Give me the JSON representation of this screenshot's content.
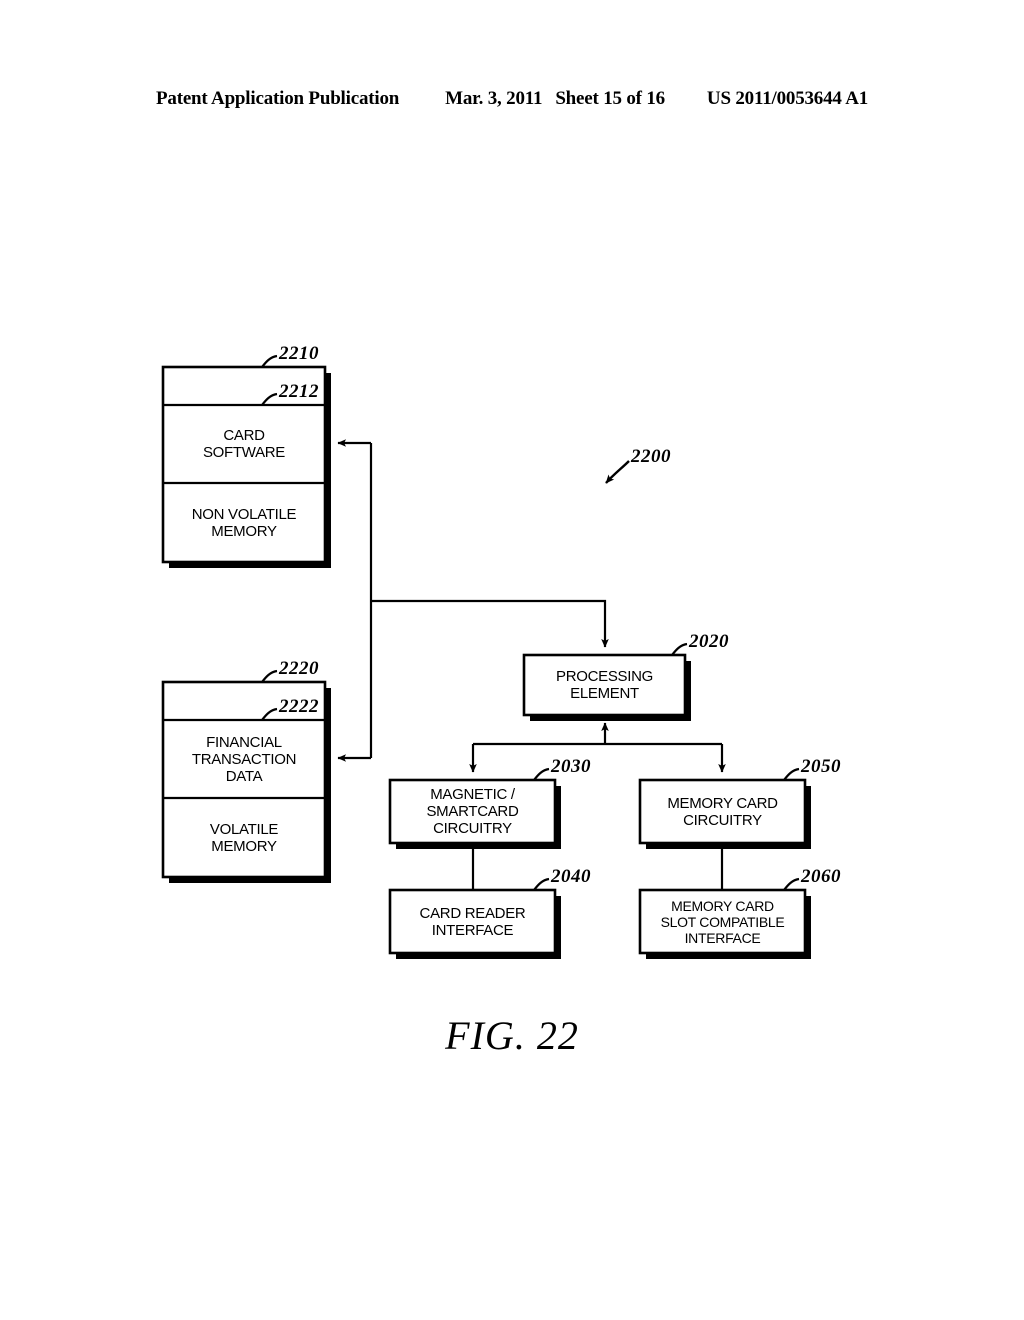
{
  "header": {
    "publication": "Patent Application Publication",
    "date": "Mar. 3, 2011",
    "sheet": "Sheet 15 of 16",
    "patent_number": "US 2011/0053644 A1"
  },
  "figure": {
    "caption": "FIG. 22",
    "system_ref": "2200",
    "blocks": {
      "nonvolatile_memory_unit": {
        "ref": "2210",
        "header_strip_label": "",
        "content_ref": "2212",
        "content_label_line1": "CARD",
        "content_label_line2": "SOFTWARE",
        "memory_label_line1": "NON VOLATILE",
        "memory_label_line2": "MEMORY"
      },
      "volatile_memory_unit": {
        "ref": "2220",
        "header_strip_label": "",
        "content_ref": "2222",
        "content_label_line1": "FINANCIAL",
        "content_label_line2": "TRANSACTION",
        "content_label_line3": "DATA",
        "memory_label_line1": "VOLATILE",
        "memory_label_line2": "MEMORY"
      },
      "processing_element": {
        "ref": "2020",
        "label_line1": "PROCESSING",
        "label_line2": "ELEMENT"
      },
      "magnetic_smartcard_circuitry": {
        "ref": "2030",
        "label_line1": "MAGNETIC /",
        "label_line2": "SMARTCARD",
        "label_line3": "CIRCUITRY"
      },
      "card_reader_interface": {
        "ref": "2040",
        "label_line1": "CARD READER",
        "label_line2": "INTERFACE"
      },
      "memory_card_circuitry": {
        "ref": "2050",
        "label_line1": "MEMORY CARD",
        "label_line2": "CIRCUITRY"
      },
      "memory_card_slot_interface": {
        "ref": "2060",
        "label_line1": "MEMORY CARD",
        "label_line2": "SLOT COMPATIBLE",
        "label_line3": "INTERFACE"
      }
    }
  },
  "colors": {
    "ink": "#000000",
    "paper": "#ffffff"
  }
}
